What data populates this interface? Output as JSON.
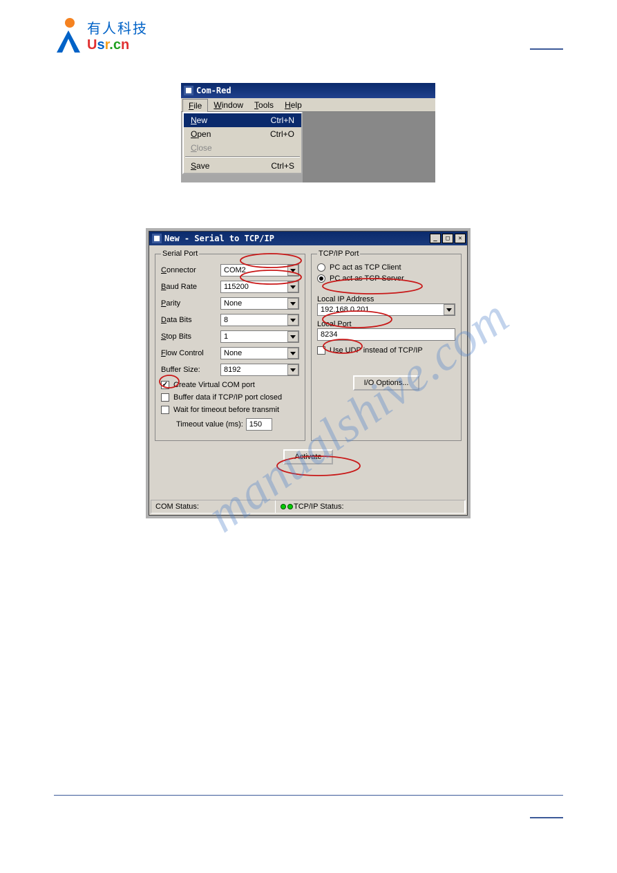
{
  "logo": {
    "cn": "有人科技",
    "en_parts": [
      "U",
      "s",
      "r",
      ".",
      "c",
      "n"
    ]
  },
  "menu_window": {
    "title": "Com-Red",
    "menubar": [
      "File",
      "Window",
      "Tools",
      "Help"
    ],
    "items": [
      {
        "label": "New",
        "shortcut": "Ctrl+N",
        "selected": true
      },
      {
        "label": "Open",
        "shortcut": "Ctrl+O",
        "selected": false
      },
      {
        "label": "Close",
        "shortcut": "",
        "disabled": true
      }
    ],
    "sep_item": {
      "label": "Save",
      "shortcut": "Ctrl+S"
    }
  },
  "dialog": {
    "title": "New - Serial to TCP/IP",
    "serial": {
      "legend": "Serial Port",
      "fields": {
        "connector": {
          "label": "Connector",
          "value": "COM2"
        },
        "baud": {
          "label": "Baud Rate",
          "value": "115200"
        },
        "parity": {
          "label": "Parity",
          "value": "None"
        },
        "data_bits": {
          "label": "Data Bits",
          "value": "8"
        },
        "stop_bits": {
          "label": "Stop Bits",
          "value": "1"
        },
        "flow": {
          "label": "Flow Control",
          "value": "None"
        },
        "buffer": {
          "label": "Buffer Size:",
          "value": "8192"
        }
      },
      "create_vcom": {
        "label": "Create Virtual COM port",
        "checked": true
      },
      "buffer_data": {
        "label": "Buffer data if TCP/IP port closed",
        "checked": false
      },
      "wait_timeout": {
        "label": "Wait for timeout before transmit",
        "checked": false
      },
      "timeout_label": "Timeout value (ms):",
      "timeout_value": "150"
    },
    "tcp": {
      "legend": "TCP/IP Port",
      "radio_client": "PC act as TCP Client",
      "radio_server": "PC act as TCP Server",
      "server_selected": true,
      "local_ip_label": "Local IP Address",
      "local_ip": "192.168.0.201",
      "local_port_label": "Local Port",
      "local_port": "8234",
      "use_udp": {
        "label": "Use UDP instead of TCP/IP",
        "checked": false
      },
      "io_options": "I/O Options..."
    },
    "activate": "Activate",
    "status": {
      "com": "COM Status:",
      "tcp": "TCP/IP Status:"
    }
  },
  "watermark": "manualshive.com"
}
